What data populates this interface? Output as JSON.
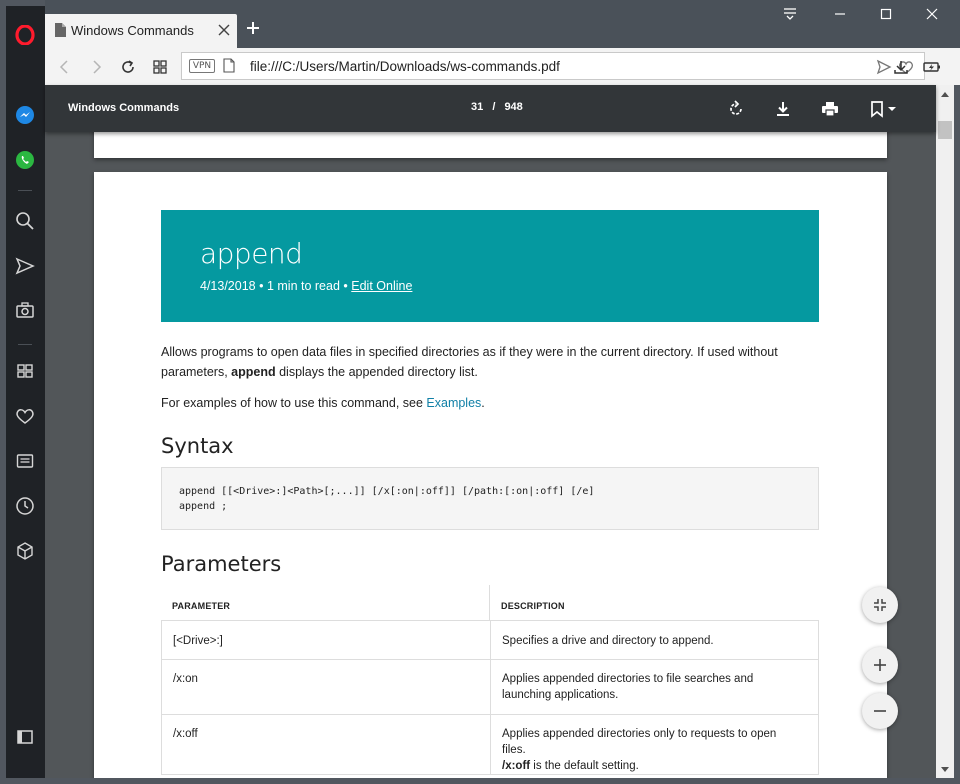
{
  "browser": {
    "tab_title": "Windows Commands",
    "url": "file:///C:/Users/Martin/Downloads/ws-commands.pdf",
    "vpn_label": "VPN"
  },
  "pdf_toolbar": {
    "title": "Windows Commands",
    "current_page": "31",
    "separator": "/",
    "total_pages": "948"
  },
  "document": {
    "banner": {
      "title": "append",
      "date": "4/13/2018",
      "read_time": "1 min to read",
      "edit_link": "Edit Online"
    },
    "intro": {
      "part1": "Allows programs to open data files in specified directories as if they were in the current directory. If used without parameters, ",
      "bold": "append",
      "part2": " displays the appended directory list."
    },
    "examples_line": {
      "prefix": "For examples of how to use this command, see ",
      "link": "Examples",
      "suffix": "."
    },
    "syntax_heading": "Syntax",
    "syntax_lines": [
      "append [[<Drive>:]<Path>[;...]] [/x[:on|:off]] [/path:[:on|:off] [/e]",
      "append ;"
    ],
    "parameters_heading": "Parameters",
    "table": {
      "headers": [
        "PARAMETER",
        "DESCRIPTION"
      ],
      "rows": [
        {
          "param": "[<Drive>:]",
          "desc": "Specifies a drive and directory to append."
        },
        {
          "param": "/x:on",
          "desc": "Applies appended directories to file searches and launching applications."
        },
        {
          "param": "/x:off",
          "desc_part1": "Applies appended directories only to requests to open files.",
          "desc_bold": "/x:off",
          "desc_part2": " is the default setting."
        }
      ]
    }
  },
  "colors": {
    "banner": "#0599a0",
    "pdf_toolbar": "#323639",
    "link": "#0f7fa6"
  }
}
